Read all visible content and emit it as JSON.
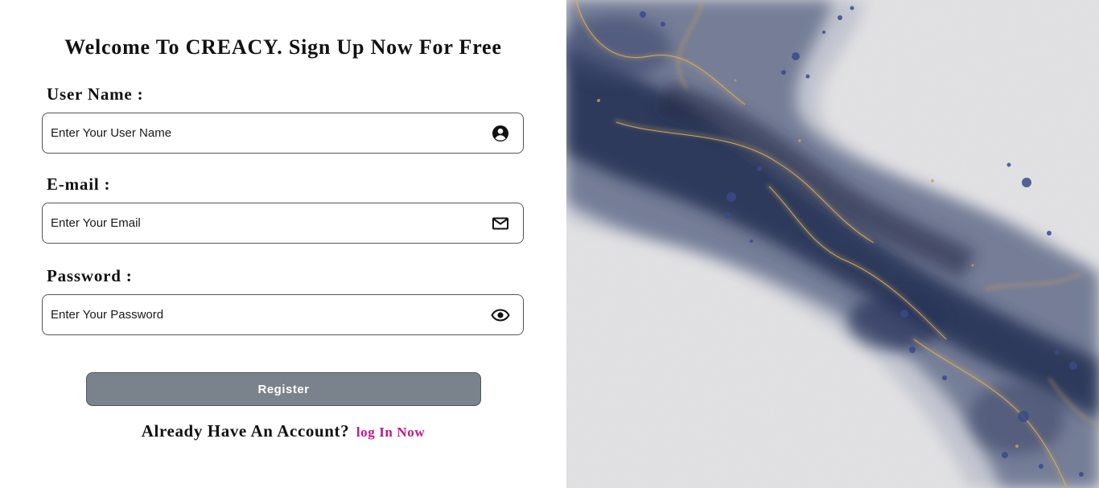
{
  "form": {
    "title": "Welcome To CREACY. Sign Up Now For Free",
    "username": {
      "label": "User Name :",
      "placeholder": "Enter Your User Name",
      "icon": "user-circle-icon"
    },
    "email": {
      "label": "E-mail :",
      "placeholder": "Enter Your Email",
      "icon": "envelope-icon"
    },
    "password": {
      "label": "Password :",
      "placeholder": "Enter Your Password",
      "icon": "eye-icon"
    },
    "register_label": "Register",
    "footer": {
      "question": "Already Have An Account?",
      "login_link": "log In Now"
    }
  },
  "colors": {
    "button_bg": "#7a838b",
    "link": "#c2188b",
    "ink_navy": "#1e2a4a",
    "gold_vein": "#c9a15a",
    "paper": "#e4e4e6"
  }
}
